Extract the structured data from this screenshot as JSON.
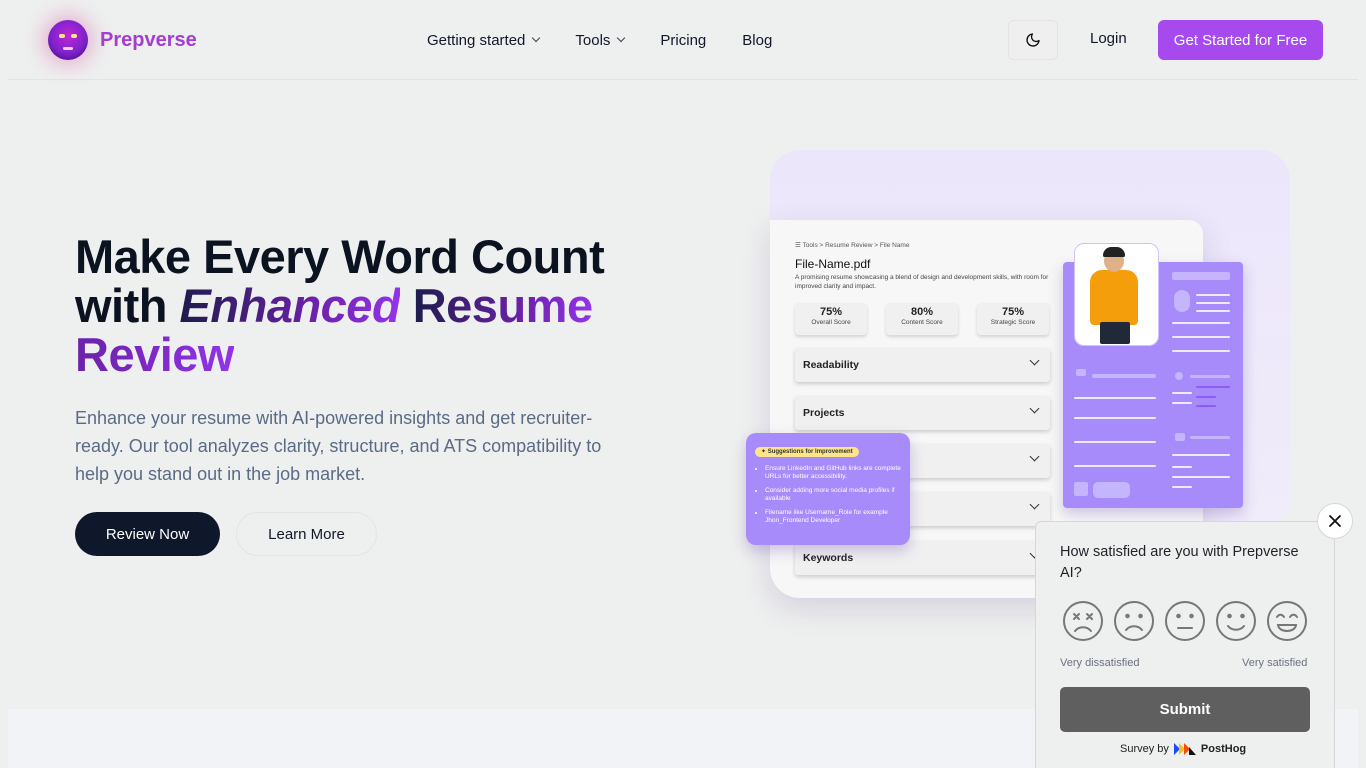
{
  "nav": {
    "brand": "Prepverse",
    "menu": [
      {
        "label": "Getting started",
        "dropdown": true
      },
      {
        "label": "Tools",
        "dropdown": true
      },
      {
        "label": "Pricing",
        "dropdown": false
      },
      {
        "label": "Blog",
        "dropdown": false
      }
    ],
    "theme_icon": "moon-icon",
    "login_label": "Login",
    "cta_label": "Get Started for Free"
  },
  "hero": {
    "title_line1": "Make Every Word Count",
    "title_with": "with",
    "title_emphasis": "Enhanced",
    "title_resume": "Resume",
    "title_review": "Review",
    "lede": "Enhance your resume with AI-powered insights and get recruiter-ready. Our tool analyzes clarity, structure, and ATS compatibility to help you stand out in the job market.",
    "primary_label": "Review Now",
    "secondary_label": "Learn More"
  },
  "illustration": {
    "breadcrumb": "Tools  >  Resume Review > File Name",
    "file_name": "File-Name.pdf",
    "file_desc": "A promising resume showcasing a blend of design and development skills, with room for improved clarity and impact.",
    "scores": [
      {
        "value": "75%",
        "label": "Overall Score"
      },
      {
        "value": "80%",
        "label": "Content Score"
      },
      {
        "value": "75%",
        "label": "Strategic Score"
      }
    ],
    "sections": [
      "Readability",
      "Projects",
      "",
      "",
      "Keywords"
    ],
    "suggestions_tag": "Suggestions for Improvement",
    "suggestions": [
      "Ensure LinkedIn and GitHub links are complete URLs for better accessibility.",
      "Consider adding more social media profiles if available",
      "Filename like Username_Role for example Jhon_Frontend Developer"
    ]
  },
  "survey": {
    "question": "How satisfied are you with Prepverse AI?",
    "low_label": "Very dissatisfied",
    "high_label": "Very satisfied",
    "submit_label": "Submit",
    "survey_by": "Survey by",
    "provider": "PostHog"
  },
  "colors": {
    "brand": "#a53ed0",
    "cta": "#a64af0",
    "dark": "#0f172a",
    "illustration_purple": "#a78bfa"
  }
}
